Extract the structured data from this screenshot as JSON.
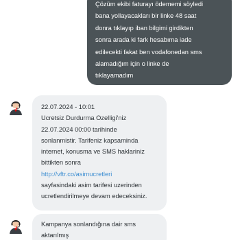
{
  "user_message": {
    "lines": [
      "Çözüm ekibi faturayı ödememi söyledi",
      "bana yollayacakları bir linke 48 saat",
      "donra tıklayıp iban bilgimi girdikten",
      "sonra arada ki fark hesabıma iade",
      "edilecekti fakat ben vodafonedan sms",
      "alamadığım için o linke de",
      "tıklayamadım"
    ]
  },
  "bot_message_1": {
    "timestamp": "22.07.2024 - 10:01",
    "lines": [
      "Ucretsiz Durdurma Ozelligi'niz",
      "22.07.2024 00:00 tarihinde",
      "sonlanmistir. Tarifeniz kapsaminda",
      "internet, konusma ve SMS haklariniz",
      "bittikten sonra"
    ],
    "link_text": "http://vftr.co/asimucretleri",
    "lines_after": [
      "sayfasindaki asim tarifesi uzerinden",
      "ucretlendirilmeye devam edeceksiniz."
    ]
  },
  "bot_message_2": {
    "lines": [
      "Kampanya sonlandığına dair sms",
      "aktarılmış"
    ]
  },
  "colors": {
    "user_bubble": "#4b5357",
    "bot_bubble": "#eef0f2",
    "link": "#3f8fd2",
    "avatar_accent": "#e60000"
  }
}
